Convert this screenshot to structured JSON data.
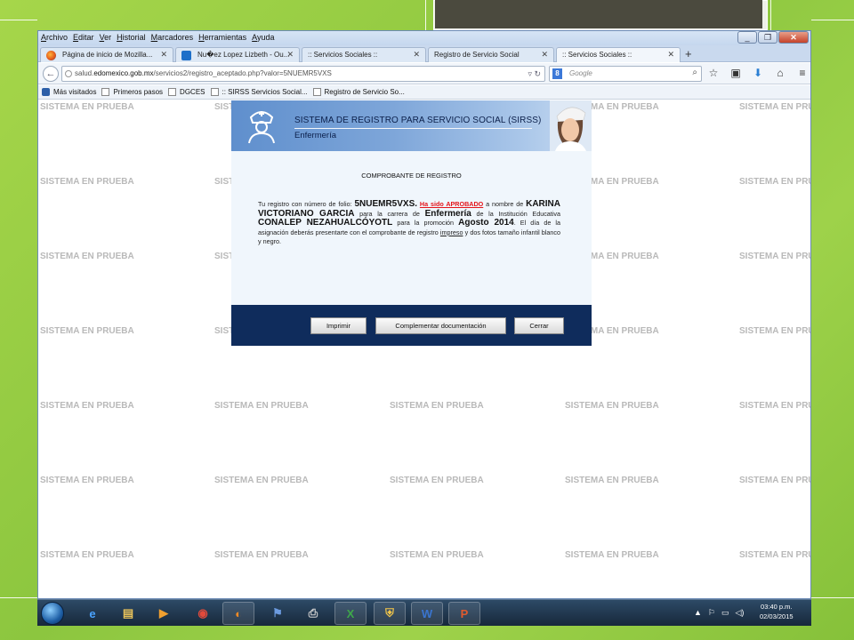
{
  "menu": [
    "Archivo",
    "Editar",
    "Ver",
    "Historial",
    "Marcadores",
    "Herramientas",
    "Ayuda"
  ],
  "tabs": [
    {
      "label": "Página de inicio de Mozilla...",
      "icon": "firefox-icon"
    },
    {
      "label": "Nu�ez Lopez Lizbeth - Ou...",
      "icon": "outlook-icon"
    },
    {
      "label": ":: Servicios Sociales ::",
      "icon": "page-icon"
    },
    {
      "label": "Registro de Servicio Social",
      "icon": "page-icon"
    },
    {
      "label": ":: Servicios Sociales ::",
      "icon": "page-icon"
    }
  ],
  "url": {
    "prefix": "salud.",
    "domain": "edomexico.gob.mx",
    "path": "/servicios2/registro_aceptado.php?valor=5NUEMR5VXS"
  },
  "search": {
    "engine": "8",
    "placeholder": "Google"
  },
  "bookmarks": [
    "Más visitados",
    "Primeros pasos",
    "DGCES",
    ":: SIRSS Servicios Social...",
    "Registro de Servicio So..."
  ],
  "watermark": "SISTEMA EN PRUEBA",
  "panel": {
    "title": "SISTEMA DE REGISTRO PARA SERVICIO SOCIAL (SIRSS)",
    "subtitle": "Enfermería",
    "receipt_title": "COMPROBANTE DE REGISTRO",
    "body": {
      "t1": "Tu registro con número de folio: ",
      "folio": "5NUEMR5VXS.",
      "approved": "Ha sido APROBADO",
      "t2": " a nombre de ",
      "name": "KARINA VICTORIANO GARCIA",
      "t3": " para la carrera de ",
      "career": "Enfermería",
      "t4": " de la Institución Educativa ",
      "institution": "CONALEP NEZAHUALCÓYOTL",
      "t5": " para la promoción ",
      "promotion": "Agosto 2014",
      "t6": ". El día de la asignación deberás presentarte con el comprobante de registro ",
      "printed": "impreso",
      "t7": " y dos fotos tamaño infantil blanco y negro."
    },
    "buttons": {
      "print": "Imprimir",
      "complement": "Complementar documentación",
      "close": "Cerrar"
    }
  },
  "taskbar": {
    "apps": [
      "ie-icon",
      "explorer-icon",
      "media-player-icon",
      "chrome-icon",
      "firefox-icon",
      "flag-icon",
      "scanner-icon",
      "excel-icon",
      "security-icon",
      "word-icon",
      "powerpoint-icon"
    ],
    "time": "03:40 p.m.",
    "date": "02/03/2015"
  },
  "colors": {
    "accent": "#0f2c5c",
    "approved": "#e4141a",
    "slide_green": "#8cc63f"
  }
}
